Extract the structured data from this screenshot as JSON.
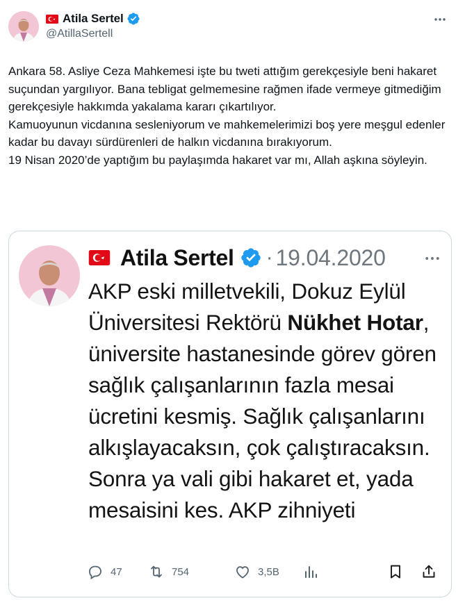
{
  "author": {
    "display_name": "Atila Sertel",
    "handle": "@AtillaSertell",
    "flag": "turkey-flag-icon",
    "verified": "verified-badge-icon"
  },
  "tweet": {
    "lines": [
      "Ankara 58. Asliye Ceza Mahkemesi işte bu tweti attığım gerekçesiyle beni hakaret suçundan yargılıyor. Bana tebligat gelmemesine rağmen ifade vermeye gitmediğim gerekçesiyle hakkımda yakalama kararı çıkartılıyor.",
      "Kamuoyunun vicdanına sesleniyorum ve mahkemelerimizi boş yere meşgul edenler kadar bu davayı sürdürenleri de halkın vicdanına bırakıyorum.",
      "19 Nisan 2020’de yaptığım bu paylaşımda hakaret var mı, Allah aşkına söyleyin."
    ]
  },
  "quoted_image": {
    "name": "Atila Sertel",
    "separator": "·",
    "date": "19.04.2020",
    "text_part1": "AKP eski milletvekili, Dokuz Eylül Üniversitesi Rektörü ",
    "text_bold": "Nükhet Hotar",
    "text_part2": ", üniversite hastanesinde görev gören sağlık çalışanlarının fazla mesai ücretini kesmiş. Sağlık çalışanlarını alkışlayacaksın, çok çalıştıracaksın. Sonra ya vali gibi hakaret et, yada mesaisini kes. AKP zihniyeti",
    "reply_count": "47",
    "retweet_count": "754",
    "like_count": "3,5B"
  },
  "colors": {
    "text": "#0f1419",
    "secondary": "#536471",
    "verified_blue": "#1d9bf0",
    "flag_red": "#e30a17",
    "border": "#cfd9de"
  },
  "icons": [
    "more-icon",
    "reply-icon",
    "retweet-icon",
    "like-icon",
    "views-icon",
    "bookmark-icon",
    "share-icon"
  ]
}
